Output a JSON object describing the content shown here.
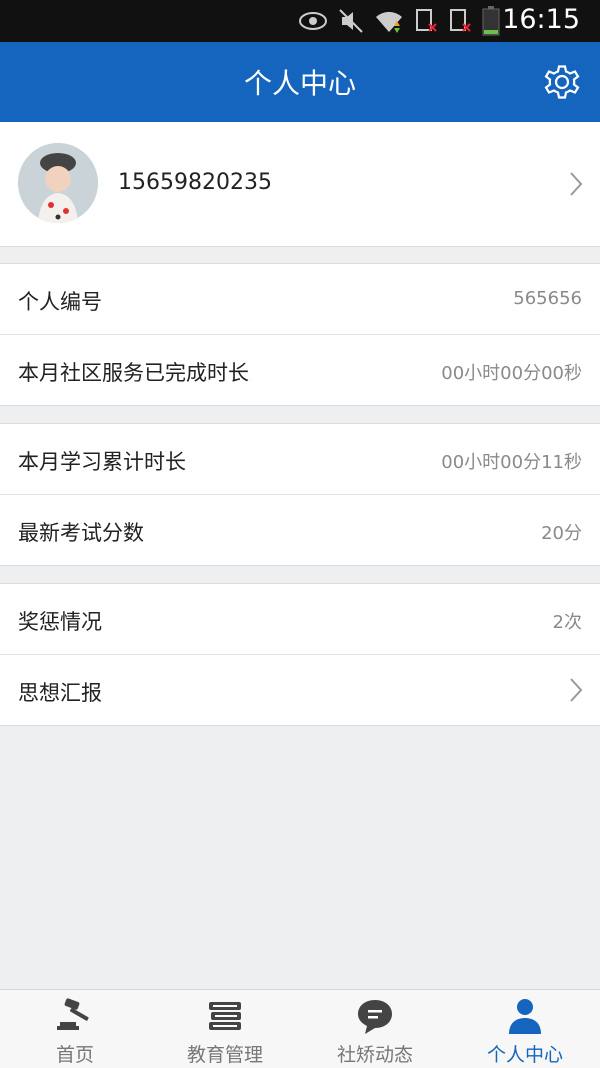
{
  "statusbar": {
    "time": "16:15"
  },
  "header": {
    "title": "个人中心"
  },
  "profile": {
    "phone": "15659820235"
  },
  "groups": [
    [
      {
        "label": "个人编号",
        "value": "565656"
      },
      {
        "label": "本月社区服务已完成时长",
        "value": "00小时00分00秒"
      }
    ],
    [
      {
        "label": "本月学习累计时长",
        "value": "00小时00分11秒"
      },
      {
        "label": "最新考试分数",
        "value": "20分"
      }
    ],
    [
      {
        "label": "奖惩情况",
        "value": "2次"
      },
      {
        "label": "思想汇报",
        "value": ""
      }
    ]
  ],
  "tabs": [
    {
      "label": "首页",
      "icon": "gavel-icon"
    },
    {
      "label": "教育管理",
      "icon": "books-icon"
    },
    {
      "label": "社矫动态",
      "icon": "chat-bubble-icon"
    },
    {
      "label": "个人中心",
      "icon": "person-icon"
    }
  ],
  "colors": {
    "primary": "#1565bf",
    "status_bar": "#111111",
    "background": "#eeeff1"
  }
}
